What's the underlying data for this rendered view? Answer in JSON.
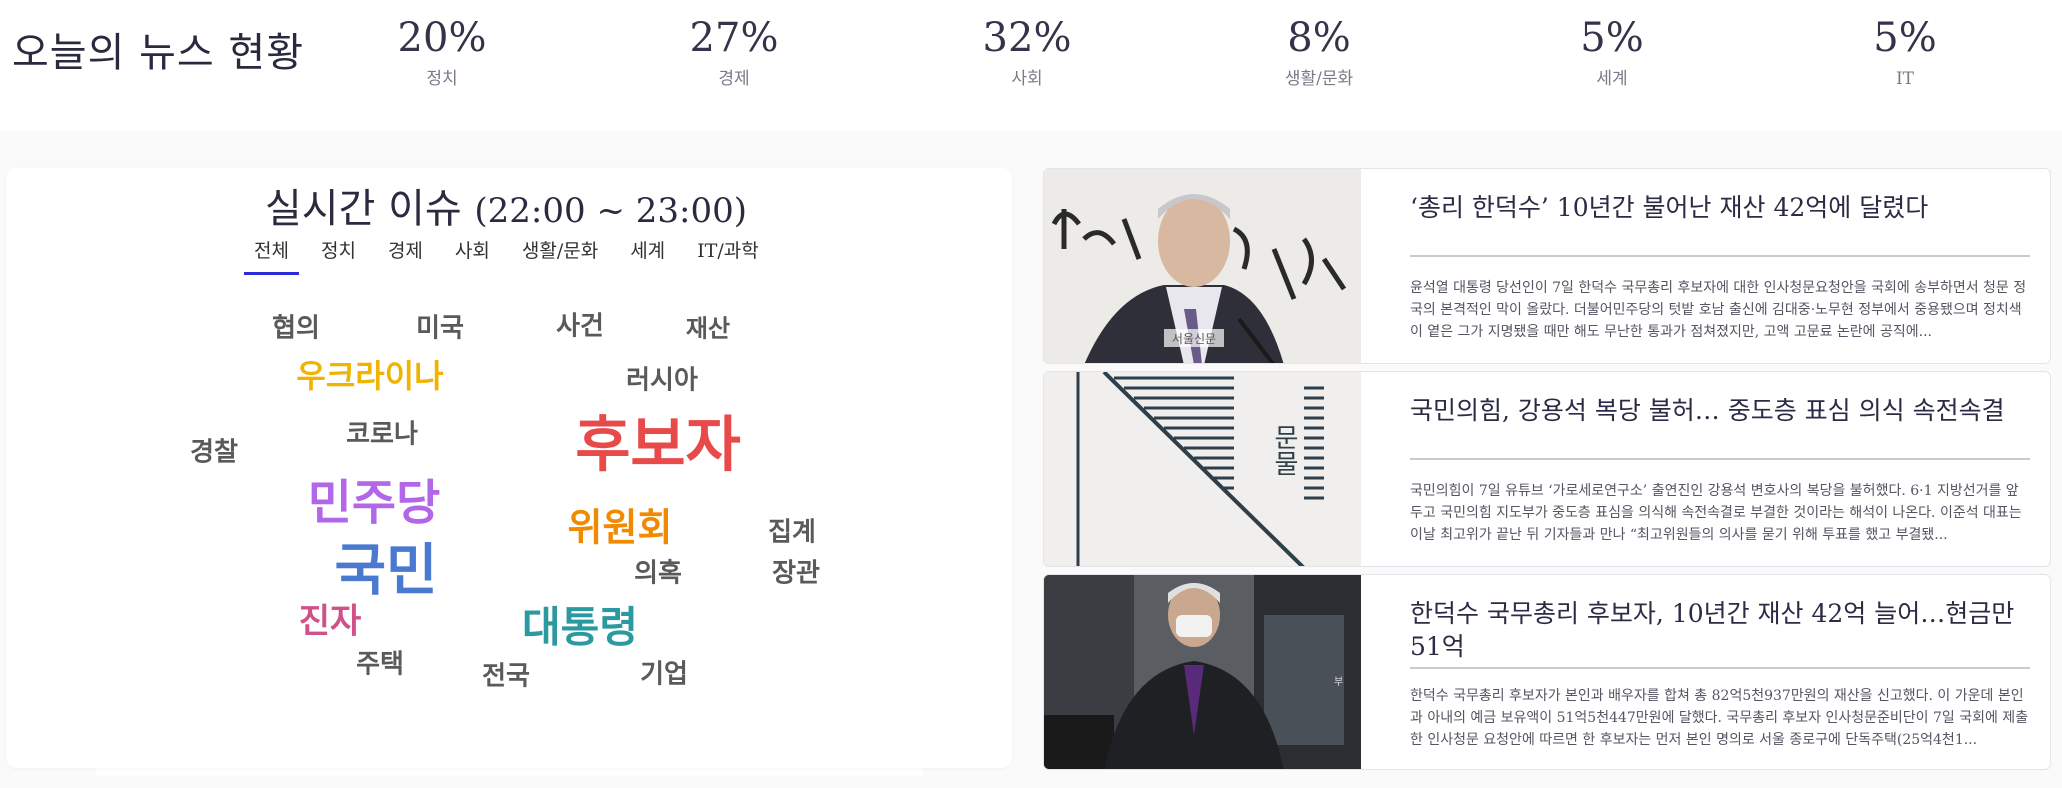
{
  "header": {
    "title": "오늘의 뉴스 현황",
    "stats": [
      {
        "percent": "20%",
        "category": "정치"
      },
      {
        "percent": "27%",
        "category": "경제"
      },
      {
        "percent": "32%",
        "category": "사회"
      },
      {
        "percent": "8%",
        "category": "생활/문화"
      },
      {
        "percent": "5%",
        "category": "세계"
      },
      {
        "percent": "5%",
        "category": "IT"
      }
    ]
  },
  "issues": {
    "title": "실시간 이슈",
    "time_range": "(22:00 ~ 23:00)",
    "tabs": [
      "전체",
      "정치",
      "경제",
      "사회",
      "생활/문화",
      "세계",
      "IT/과학"
    ],
    "active_tab": "전체",
    "words": [
      {
        "text": "협의",
        "color": "#5a5a5a"
      },
      {
        "text": "미국",
        "color": "#5a5a5a"
      },
      {
        "text": "사건",
        "color": "#5a5a5a"
      },
      {
        "text": "재산",
        "color": "#5a5a5a"
      },
      {
        "text": "우크라이나",
        "color": "#f0b400"
      },
      {
        "text": "러시아",
        "color": "#5a5a5a"
      },
      {
        "text": "코로나",
        "color": "#5a5a5a"
      },
      {
        "text": "후보자",
        "color": "#e84a4a"
      },
      {
        "text": "경찰",
        "color": "#5a5a5a"
      },
      {
        "text": "민주당",
        "color": "#b266e8"
      },
      {
        "text": "위원회",
        "color": "#f08a00"
      },
      {
        "text": "집계",
        "color": "#5a5a5a"
      },
      {
        "text": "국민",
        "color": "#4a7ad0"
      },
      {
        "text": "의혹",
        "color": "#5a5a5a"
      },
      {
        "text": "장관",
        "color": "#5a5a5a"
      },
      {
        "text": "진자",
        "color": "#d0508a"
      },
      {
        "text": "대통령",
        "color": "#2a9aa0"
      },
      {
        "text": "주택",
        "color": "#5a5a5a"
      },
      {
        "text": "전국",
        "color": "#5a5a5a"
      },
      {
        "text": "기업",
        "color": "#5a5a5a"
      }
    ]
  },
  "news": [
    {
      "headline": "‘총리 한덕수’ 10년간 불어난 재산 42억에 달렸다",
      "summary": "윤석열 대통령 당선인이 7일 한덕수 국무총리 후보자에 대한 인사청문요청안을 국회에 송부하면서 청문 정국의 본격적인 막이 올랐다. 더불어민주당의 텃밭 호남 출신에 김대중·노무현 정부에서 중용됐으며 정치색이 옅은 그가 지명됐을 때만 해도 무난한 통과가 점쳐졌지만, 고액 고문료 논란에 공직에...",
      "image_caption": "서울신문"
    },
    {
      "headline": "국민의힘, 강용석 복당 불허… 중도층 표심 의식 속전속결",
      "summary": "국민의힘이 7일 유튜브 ‘가로세로연구소’ 출연진인 강용석 변호사의 복당을 불허했다. 6·1 지방선거를 앞두고 국민의힘 지도부가 중도층 표심을 의식해 속전속결로 부결한 것이라는 해석이 나온다. 이준석 대표는 이날 최고위가 끝난 뒤 기자들과 만나 “최고위원들의 의사를 묻기 위해 투표를 했고 부결됐...",
      "image_caption": "문물"
    },
    {
      "headline": "한덕수 국무총리 후보자, 10년간 재산 42억 늘어…현금만 51억",
      "summary": "한덕수 국무총리 후보자가 본인과 배우자를 합쳐 총 82억5천937만원의 재산을 신고했다. 이 가운데 본인과 아내의 예금 보유액이 51억5천447만원에 달했다. 국무총리 후보자 인사청문준비단이 7일 국회에 제출한 인사청문 요청안에 따르면 한 후보자는 먼저 본인 명의로 서울 종로구에 단독주택(25억4천1...",
      "image_caption": "부"
    }
  ]
}
